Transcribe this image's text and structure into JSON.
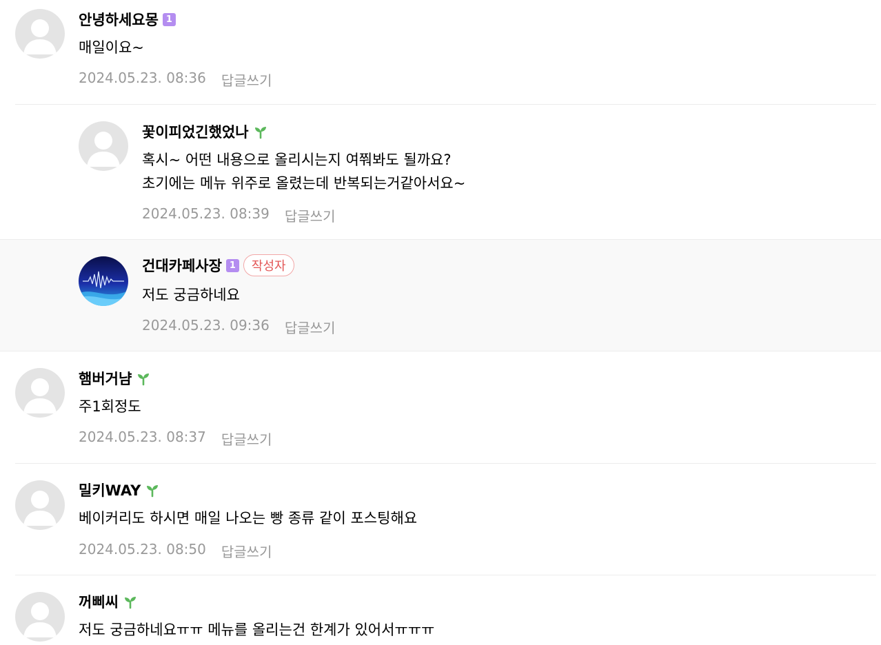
{
  "comments": [
    {
      "nickname": "안녕하세요몽",
      "level": "1",
      "text": [
        "매일이요~"
      ],
      "date": "2024.05.23. 08:36",
      "reply_label": "답글쓰기"
    },
    {
      "nickname": "꽃이피었긴했었나",
      "text": [
        "혹시~ 어떤 내용으로 올리시는지 여쭤봐도 될까요?",
        "초기에는 메뉴 위주로 올렸는데 반복되는거같아서요~"
      ],
      "date": "2024.05.23. 08:39",
      "reply_label": "답글쓰기"
    },
    {
      "nickname": "건대카페사장",
      "level": "1",
      "author_badge": "작성자",
      "text": [
        "저도 궁금하네요"
      ],
      "date": "2024.05.23. 09:36",
      "reply_label": "답글쓰기"
    },
    {
      "nickname": "햄버거냠",
      "text": [
        "주1회정도"
      ],
      "date": "2024.05.23. 08:37",
      "reply_label": "답글쓰기"
    },
    {
      "nickname": "밀키WAY",
      "text": [
        "베이커리도 하시면 매일 나오는 빵 종류 같이 포스팅해요"
      ],
      "date": "2024.05.23. 08:50",
      "reply_label": "답글쓰기"
    },
    {
      "nickname": "꺼삐씨",
      "text": [
        "저도 궁금하네요ㅠㅠ 메뉴를 올리는건 한계가 있어서ㅠㅠㅠ"
      ]
    }
  ],
  "colors": {
    "level_badge": "#b48df0",
    "sprout": "#5cb85c",
    "author_badge": "#e35656",
    "meta_text": "#999999",
    "highlight_bg": "#f9f9f9"
  }
}
